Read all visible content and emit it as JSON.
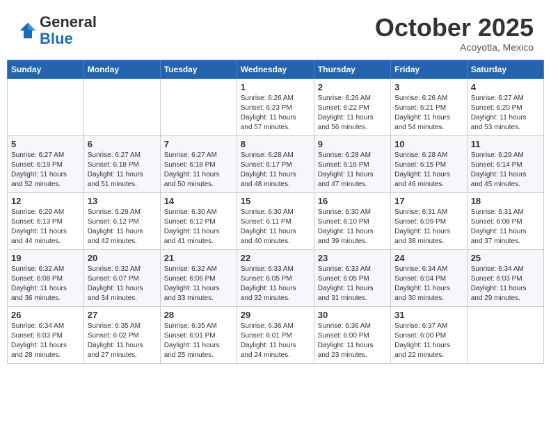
{
  "header": {
    "logo_line1": "General",
    "logo_line2": "Blue",
    "month": "October 2025",
    "location": "Acoyotla, Mexico"
  },
  "weekdays": [
    "Sunday",
    "Monday",
    "Tuesday",
    "Wednesday",
    "Thursday",
    "Friday",
    "Saturday"
  ],
  "weeks": [
    [
      {
        "day": "",
        "info": ""
      },
      {
        "day": "",
        "info": ""
      },
      {
        "day": "",
        "info": ""
      },
      {
        "day": "1",
        "info": "Sunrise: 6:26 AM\nSunset: 6:23 PM\nDaylight: 11 hours\nand 57 minutes."
      },
      {
        "day": "2",
        "info": "Sunrise: 6:26 AM\nSunset: 6:22 PM\nDaylight: 11 hours\nand 56 minutes."
      },
      {
        "day": "3",
        "info": "Sunrise: 6:26 AM\nSunset: 6:21 PM\nDaylight: 11 hours\nand 54 minutes."
      },
      {
        "day": "4",
        "info": "Sunrise: 6:27 AM\nSunset: 6:20 PM\nDaylight: 11 hours\nand 53 minutes."
      }
    ],
    [
      {
        "day": "5",
        "info": "Sunrise: 6:27 AM\nSunset: 6:19 PM\nDaylight: 11 hours\nand 52 minutes."
      },
      {
        "day": "6",
        "info": "Sunrise: 6:27 AM\nSunset: 6:18 PM\nDaylight: 11 hours\nand 51 minutes."
      },
      {
        "day": "7",
        "info": "Sunrise: 6:27 AM\nSunset: 6:18 PM\nDaylight: 11 hours\nand 50 minutes."
      },
      {
        "day": "8",
        "info": "Sunrise: 6:28 AM\nSunset: 6:17 PM\nDaylight: 11 hours\nand 48 minutes."
      },
      {
        "day": "9",
        "info": "Sunrise: 6:28 AM\nSunset: 6:16 PM\nDaylight: 11 hours\nand 47 minutes."
      },
      {
        "day": "10",
        "info": "Sunrise: 6:28 AM\nSunset: 6:15 PM\nDaylight: 11 hours\nand 46 minutes."
      },
      {
        "day": "11",
        "info": "Sunrise: 6:29 AM\nSunset: 6:14 PM\nDaylight: 11 hours\nand 45 minutes."
      }
    ],
    [
      {
        "day": "12",
        "info": "Sunrise: 6:29 AM\nSunset: 6:13 PM\nDaylight: 11 hours\nand 44 minutes."
      },
      {
        "day": "13",
        "info": "Sunrise: 6:29 AM\nSunset: 6:12 PM\nDaylight: 11 hours\nand 42 minutes."
      },
      {
        "day": "14",
        "info": "Sunrise: 6:30 AM\nSunset: 6:12 PM\nDaylight: 11 hours\nand 41 minutes."
      },
      {
        "day": "15",
        "info": "Sunrise: 6:30 AM\nSunset: 6:11 PM\nDaylight: 11 hours\nand 40 minutes."
      },
      {
        "day": "16",
        "info": "Sunrise: 6:30 AM\nSunset: 6:10 PM\nDaylight: 11 hours\nand 39 minutes."
      },
      {
        "day": "17",
        "info": "Sunrise: 6:31 AM\nSunset: 6:09 PM\nDaylight: 11 hours\nand 38 minutes."
      },
      {
        "day": "18",
        "info": "Sunrise: 6:31 AM\nSunset: 6:08 PM\nDaylight: 11 hours\nand 37 minutes."
      }
    ],
    [
      {
        "day": "19",
        "info": "Sunrise: 6:32 AM\nSunset: 6:08 PM\nDaylight: 11 hours\nand 36 minutes."
      },
      {
        "day": "20",
        "info": "Sunrise: 6:32 AM\nSunset: 6:07 PM\nDaylight: 11 hours\nand 34 minutes."
      },
      {
        "day": "21",
        "info": "Sunrise: 6:32 AM\nSunset: 6:06 PM\nDaylight: 11 hours\nand 33 minutes."
      },
      {
        "day": "22",
        "info": "Sunrise: 6:33 AM\nSunset: 6:05 PM\nDaylight: 11 hours\nand 32 minutes."
      },
      {
        "day": "23",
        "info": "Sunrise: 6:33 AM\nSunset: 6:05 PM\nDaylight: 11 hours\nand 31 minutes."
      },
      {
        "day": "24",
        "info": "Sunrise: 6:34 AM\nSunset: 6:04 PM\nDaylight: 11 hours\nand 30 minutes."
      },
      {
        "day": "25",
        "info": "Sunrise: 6:34 AM\nSunset: 6:03 PM\nDaylight: 11 hours\nand 29 minutes."
      }
    ],
    [
      {
        "day": "26",
        "info": "Sunrise: 6:34 AM\nSunset: 6:03 PM\nDaylight: 11 hours\nand 28 minutes."
      },
      {
        "day": "27",
        "info": "Sunrise: 6:35 AM\nSunset: 6:02 PM\nDaylight: 11 hours\nand 27 minutes."
      },
      {
        "day": "28",
        "info": "Sunrise: 6:35 AM\nSunset: 6:01 PM\nDaylight: 11 hours\nand 25 minutes."
      },
      {
        "day": "29",
        "info": "Sunrise: 6:36 AM\nSunset: 6:01 PM\nDaylight: 11 hours\nand 24 minutes."
      },
      {
        "day": "30",
        "info": "Sunrise: 6:36 AM\nSunset: 6:00 PM\nDaylight: 11 hours\nand 23 minutes."
      },
      {
        "day": "31",
        "info": "Sunrise: 6:37 AM\nSunset: 6:00 PM\nDaylight: 11 hours\nand 22 minutes."
      },
      {
        "day": "",
        "info": ""
      }
    ]
  ]
}
